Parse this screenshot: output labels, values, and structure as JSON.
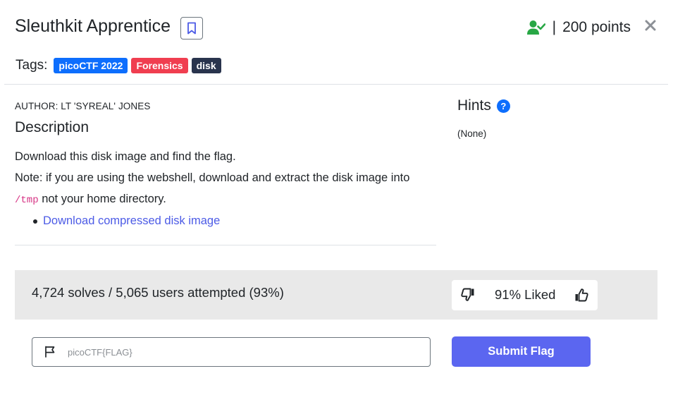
{
  "header": {
    "title": "Sleuthkit Apprentice",
    "separator": "|",
    "points": "200 points",
    "solved_icon_color": "#28a745"
  },
  "tags": {
    "label": "Tags:",
    "items": [
      {
        "label": "picoCTF 2022",
        "color": "#0d6efd"
      },
      {
        "label": "Forensics",
        "color": "#f03e50"
      },
      {
        "label": "disk",
        "color": "#29344d"
      }
    ]
  },
  "description": {
    "author": "AUTHOR: LT 'SYREAL' JONES",
    "heading": "Description",
    "line1": "Download this disk image and find the flag.",
    "line2": "Note: if you are using the webshell, download and extract the disk image into",
    "code": "/tmp",
    "line3_rest": "not your home directory.",
    "link_label": "Download compressed disk image"
  },
  "hints": {
    "heading": "Hints",
    "help_glyph": "?",
    "content": "(None)"
  },
  "stats": {
    "solves_text": "4,724 solves / 5,065 users attempted (93%)",
    "liked_text": "91% Liked"
  },
  "flag": {
    "placeholder": "picoCTF{FLAG}",
    "value": "",
    "submit_label": "Submit Flag",
    "button_color": "#5b66f0"
  },
  "icons": {
    "bookmark": "bookmark-icon",
    "solved": "user-check-icon",
    "close": "close-icon",
    "help": "question-circle-icon",
    "dislike": "thumbs-down-icon",
    "like": "thumbs-up-icon",
    "flag": "flag-icon"
  }
}
